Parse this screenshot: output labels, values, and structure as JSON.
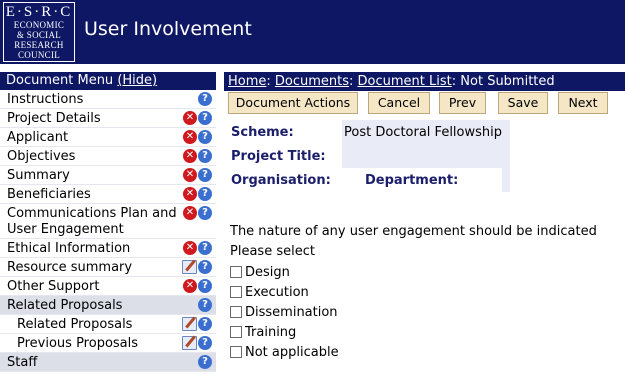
{
  "header": {
    "logo_main": "E·S·R·C",
    "logo_lines": [
      "ECONOMIC",
      "& SOCIAL",
      "RESEARCH",
      "COUNCIL"
    ],
    "title": "User Involvement"
  },
  "sidebar": {
    "menu_title": "Document Menu",
    "hide_label": "(Hide)",
    "items": [
      {
        "label": "Instructions"
      },
      {
        "label": "Project Details"
      },
      {
        "label": "Applicant"
      },
      {
        "label": "Objectives"
      },
      {
        "label": "Summary"
      },
      {
        "label": "Beneficiaries"
      },
      {
        "label": "Communications Plan and",
        "label2": "User Engagement"
      },
      {
        "label": "Ethical Information"
      },
      {
        "label": "Resource summary"
      },
      {
        "label": "Other Support"
      },
      {
        "label": "Related Proposals"
      },
      {
        "label": "Related Proposals"
      },
      {
        "label": "Previous Proposals"
      },
      {
        "label": "Staff"
      }
    ]
  },
  "breadcrumb": {
    "home": "Home",
    "sep1": ": ",
    "documents": "Documents",
    "sep2": ": ",
    "list": "Document List",
    "sep3": ": ",
    "current": "Not Submitted"
  },
  "toolbar": {
    "actions": "Document Actions",
    "cancel": "Cancel",
    "prev": "Prev",
    "save": "Save",
    "next": "Next"
  },
  "details": {
    "scheme_label": "Scheme:",
    "scheme_value": "Post Doctoral Fellowship",
    "title_label": "Project Title:",
    "org_label": "Organisation:",
    "dept_label": "Department:"
  },
  "form": {
    "question": "The nature of any user engagement should be indicated",
    "prompt": "Please select",
    "options": [
      "Design",
      "Execution",
      "Dissemination",
      "Training",
      "Not applicable"
    ]
  },
  "colors": {
    "header_bg": "#0d1763",
    "button_bg": "#f5e7c6",
    "label_color": "#1b1f6b",
    "error_icon": "#d0191f",
    "help_icon": "#3a6fd0"
  }
}
